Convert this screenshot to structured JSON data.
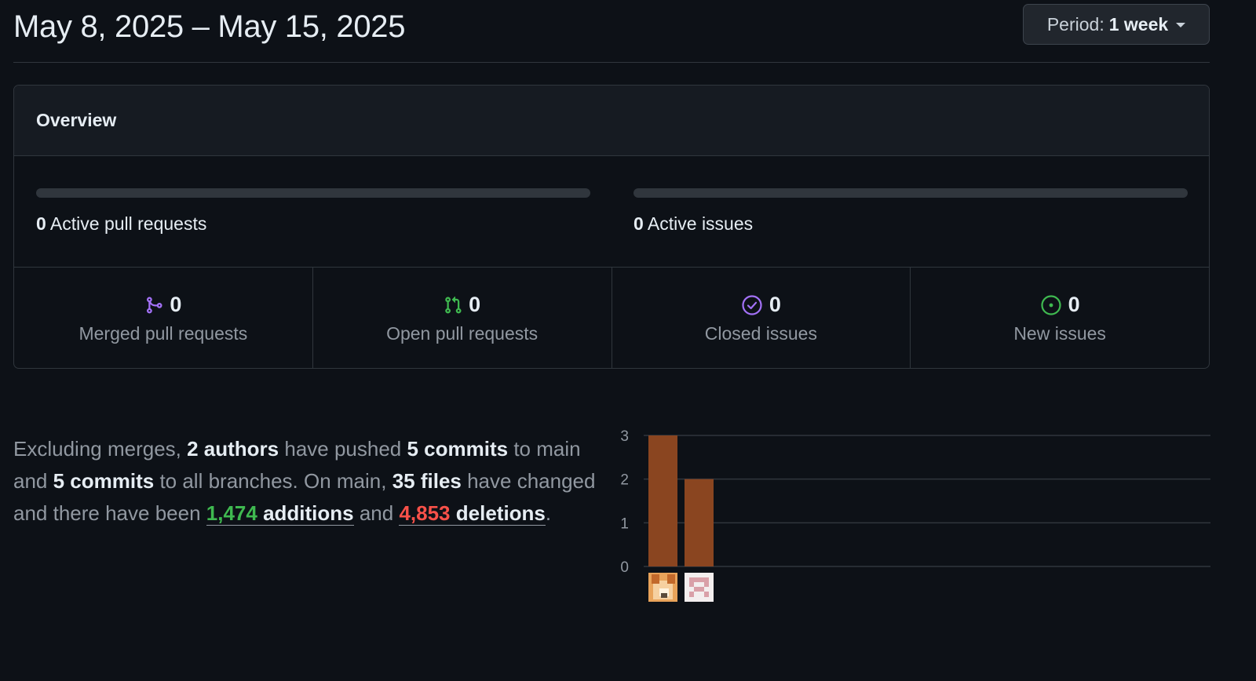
{
  "header": {
    "date_range": "May 8, 2025 – May 15, 2025",
    "period_prefix": "Period:",
    "period_value": "1 week"
  },
  "overview": {
    "title": "Overview",
    "active_pull_requests": {
      "count": "0",
      "label": "Active pull requests",
      "fill_fraction": 0
    },
    "active_issues": {
      "count": "0",
      "label": "Active issues",
      "fill_fraction": 0
    },
    "stats": [
      {
        "count": "0",
        "label": "Merged pull requests",
        "icon": "git-merge-icon",
        "color": "#a371f7"
      },
      {
        "count": "0",
        "label": "Open pull requests",
        "icon": "git-pull-request-icon",
        "color": "#3fb950"
      },
      {
        "count": "0",
        "label": "Closed issues",
        "icon": "issue-closed-icon",
        "color": "#a371f7"
      },
      {
        "count": "0",
        "label": "New issues",
        "icon": "issue-opened-icon",
        "color": "#3fb950"
      }
    ]
  },
  "summary": {
    "t1": "Excluding merges, ",
    "authors": "2 authors",
    "t2": " have pushed ",
    "commits_main": "5 commits",
    "t3": " to main and ",
    "commits_all": "5 commits",
    "t4": " to all branches. On main, ",
    "files": "35 files",
    "t5": " have changed and there have been ",
    "additions_num": "1,474",
    "additions_word": " additions",
    "t6": " and ",
    "deletions_num": "4,853",
    "deletions_word": " deletions",
    "t7": "."
  },
  "chart_data": {
    "type": "bar",
    "categories": [
      "author-1",
      "author-2"
    ],
    "values": [
      3,
      2
    ],
    "ylim": [
      0,
      3
    ],
    "yticks": [
      "0",
      "1",
      "2",
      "3"
    ],
    "grid": true,
    "bar_color": "#8a4520"
  },
  "colors": {
    "background": "#0d1117",
    "border": "#30363d",
    "additions": "#3fb950",
    "deletions": "#f85149"
  }
}
